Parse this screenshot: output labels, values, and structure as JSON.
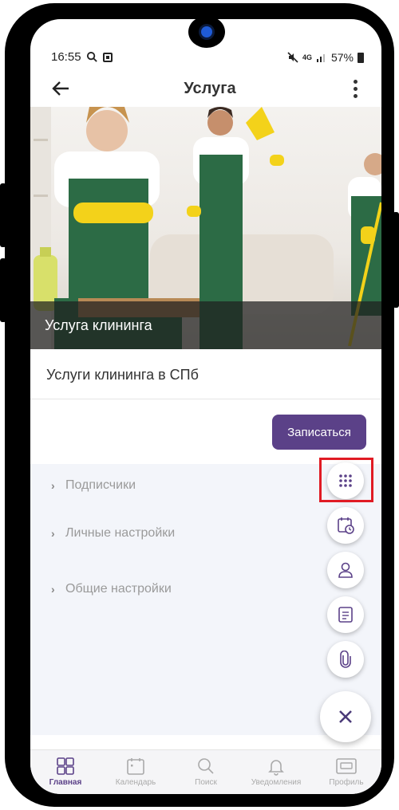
{
  "status_bar": {
    "time": "16:55",
    "network": "4G",
    "battery": "57%"
  },
  "app_bar": {
    "title": "Услуга"
  },
  "hero": {
    "caption": "Услуга клининга"
  },
  "service": {
    "description": "Услуги клининга в СПб",
    "signup_label": "Записаться"
  },
  "settings": {
    "items": [
      {
        "label": "Подписчики"
      },
      {
        "label": "Личные настройки"
      },
      {
        "label": "Общие настройки"
      }
    ]
  },
  "fab_menu": {
    "items": [
      "grid-icon",
      "calendar-clock-icon",
      "user-icon",
      "note-icon",
      "attachment-icon"
    ],
    "close_icon": "close-icon"
  },
  "bottom_nav": {
    "items": [
      {
        "label": "Главная",
        "icon": "home-grid-icon"
      },
      {
        "label": "Календарь",
        "icon": "calendar-icon"
      },
      {
        "label": "Поиск",
        "icon": "search-icon"
      },
      {
        "label": "Уведомления",
        "icon": "bell-icon"
      },
      {
        "label": "Профиль",
        "icon": "profile-card-icon"
      }
    ],
    "active_index": 0
  },
  "colors": {
    "accent": "#5b4188",
    "highlight": "#e01b24"
  }
}
